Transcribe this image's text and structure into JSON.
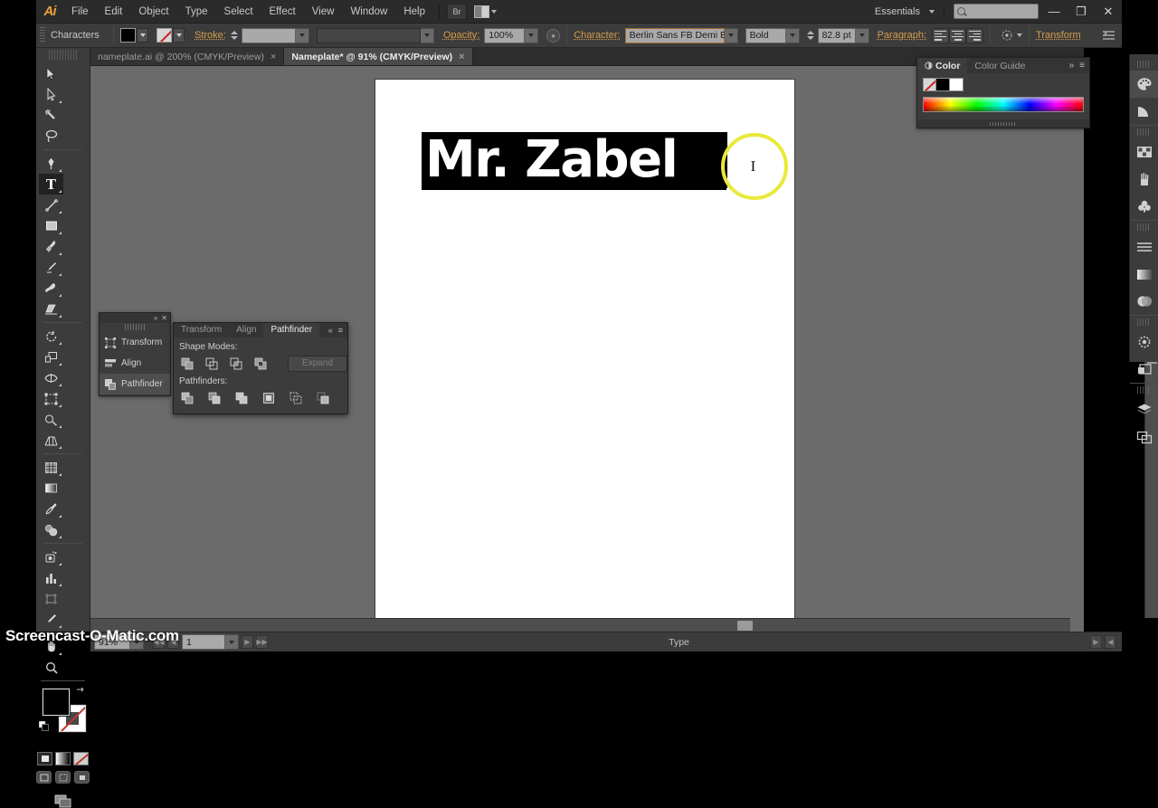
{
  "app": {
    "logo": "Ai",
    "workspace": "Essentials",
    "search_placeholder": "",
    "menus": [
      "File",
      "Edit",
      "Object",
      "Type",
      "Select",
      "Effect",
      "View",
      "Window",
      "Help"
    ],
    "bridge_button": "Br",
    "window_buttons": {
      "minimize": "—",
      "restore": "❐",
      "close": "✕"
    }
  },
  "options_bar": {
    "panel_label": "Characters",
    "stroke_label": "Stroke:",
    "stroke_weight": "",
    "stroke_profile": "",
    "opacity_label": "Opacity:",
    "opacity_value": "100%",
    "character_label": "Character:",
    "font_family": "Berlin Sans FB Demi Bold",
    "font_style": "Bold",
    "font_size": "82.8 pt",
    "paragraph_label": "Paragraph:",
    "transform_link": "Transform"
  },
  "tabs": [
    {
      "label": "nameplate.ai @ 200% (CMYK/Preview)",
      "active": false,
      "close": "×"
    },
    {
      "label": "Nameplate* @ 91% (CMYK/Preview)",
      "active": true,
      "close": "×"
    }
  ],
  "tools": [
    {
      "name": "selection-tool",
      "active": false
    },
    {
      "name": "direct-selection-tool",
      "active": false
    },
    {
      "name": "magic-wand-tool",
      "active": false
    },
    {
      "name": "lasso-tool",
      "active": false
    },
    {
      "name": "pen-tool",
      "active": false
    },
    {
      "name": "type-tool",
      "active": true
    },
    {
      "name": "line-segment-tool",
      "active": false
    },
    {
      "name": "rectangle-tool",
      "active": false
    },
    {
      "name": "paintbrush-tool",
      "active": false
    },
    {
      "name": "pencil-tool",
      "active": false
    },
    {
      "name": "blob-brush-tool",
      "active": false
    },
    {
      "name": "eraser-tool",
      "active": false
    },
    {
      "name": "rotate-tool",
      "active": false
    },
    {
      "name": "scale-tool",
      "active": false
    },
    {
      "name": "width-tool",
      "active": false
    },
    {
      "name": "free-transform-tool",
      "active": false
    },
    {
      "name": "shape-builder-tool",
      "active": false
    },
    {
      "name": "perspective-grid-tool",
      "active": false
    },
    {
      "name": "mesh-tool",
      "active": false
    },
    {
      "name": "gradient-tool",
      "active": false
    },
    {
      "name": "eyedropper-tool",
      "active": false
    },
    {
      "name": "blend-tool",
      "active": false
    },
    {
      "name": "symbol-sprayer-tool",
      "active": false
    },
    {
      "name": "column-graph-tool",
      "active": false
    },
    {
      "name": "artboard-tool",
      "active": false
    },
    {
      "name": "slice-tool",
      "active": false
    },
    {
      "name": "hand-tool",
      "active": false
    },
    {
      "name": "zoom-tool",
      "active": false
    }
  ],
  "colors": {
    "fill": "#000000",
    "stroke": "none",
    "accent_orange": "#d79b4a",
    "cursor_highlight": "#e9e93a",
    "panel_bg": "#3c3c3c",
    "canvas_bg": "#6b6b6b"
  },
  "canvas": {
    "nameplate_text": "Mr. Zabel",
    "nameplate_bg": "#000000",
    "nameplate_color": "#ffffff",
    "artboard_color": "#ffffff"
  },
  "color_panel": {
    "tabs": [
      {
        "label": "Color",
        "active": true
      },
      {
        "label": "Color Guide",
        "active": false
      }
    ],
    "collapse_icon": "»",
    "menu_icon": "≡",
    "swatches": [
      "none",
      "#000000",
      "#ffffff"
    ]
  },
  "mini_panel": {
    "collapse_icon": "»",
    "close_icon": "✕",
    "items": [
      {
        "label": "Transform",
        "icon": "transform-icon",
        "active": false
      },
      {
        "label": "Align",
        "icon": "align-icon",
        "active": false
      },
      {
        "label": "Pathfinder",
        "icon": "pathfinder-icon",
        "active": true
      }
    ]
  },
  "pathfinder_panel": {
    "tabs": [
      {
        "label": "Transform",
        "active": false
      },
      {
        "label": "Align",
        "active": false
      },
      {
        "label": "Pathfinder",
        "active": true
      }
    ],
    "collapse_icon": "«",
    "menu_icon": "≡",
    "shape_modes_label": "Shape Modes:",
    "expand_label": "Expand",
    "pathfinders_label": "Pathfinders:",
    "shape_modes": [
      "unite",
      "minus-front",
      "intersect",
      "exclude"
    ],
    "pathfinders": [
      "divide",
      "trim",
      "merge",
      "crop",
      "outline",
      "minus-back"
    ]
  },
  "right_dock": [
    {
      "name": "color-panel-icon",
      "active": true
    },
    {
      "name": "color-guide-icon",
      "active": false
    },
    {
      "name": "swatches-icon",
      "active": false
    },
    {
      "name": "brushes-icon",
      "active": false
    },
    {
      "name": "symbols-icon",
      "active": false
    },
    {
      "name": "stroke-icon",
      "active": false
    },
    {
      "name": "gradient-icon",
      "active": false
    },
    {
      "name": "transparency-icon",
      "active": false
    },
    {
      "name": "appearance-icon",
      "active": false
    },
    {
      "name": "graphic-styles-icon",
      "active": false
    },
    {
      "name": "layers-icon",
      "active": false
    },
    {
      "name": "artboards-icon",
      "active": false
    }
  ],
  "status_bar": {
    "zoom": "91%",
    "page": "1",
    "tool_label": "Type",
    "first_arrow": "◀◀",
    "prev_arrow": "◀",
    "next_arrow": "▶",
    "last_arrow": "▶▶"
  },
  "watermark": "Screencast-O-Matic.com"
}
